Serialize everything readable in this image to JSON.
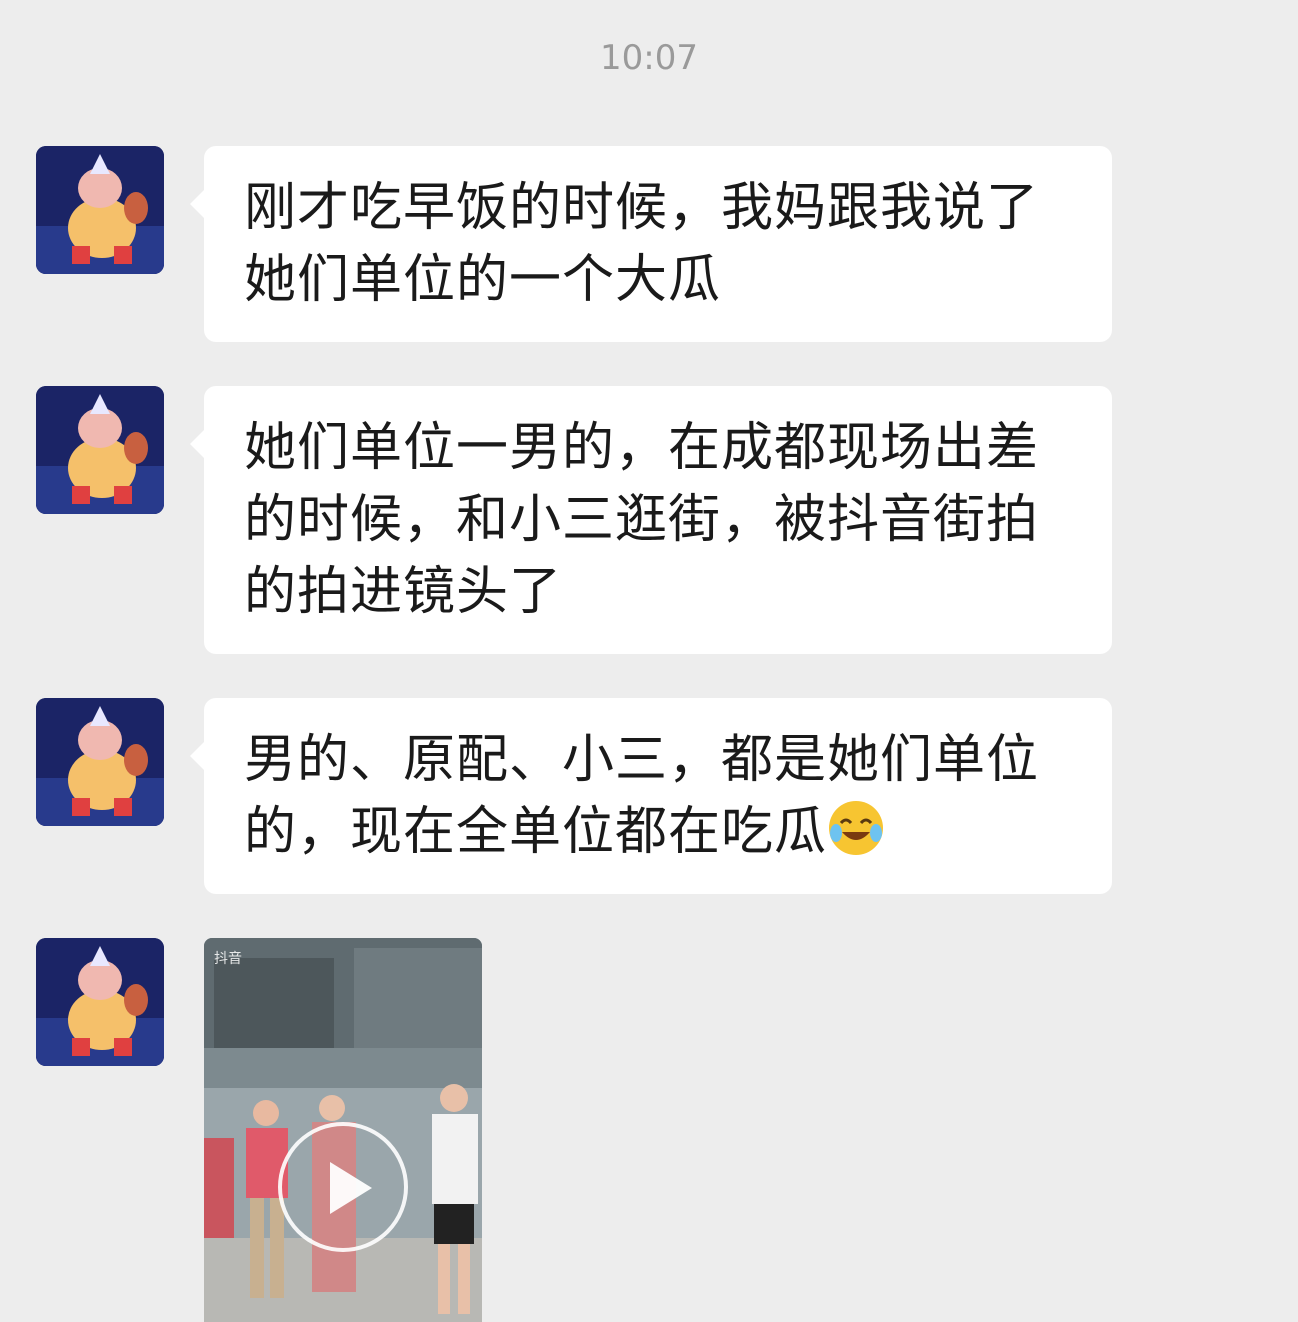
{
  "timestamp": "10:07",
  "messages": [
    {
      "text": "刚才吃早饭的时候，我妈跟我说了她们单位的一个大瓜"
    },
    {
      "text": "她们单位一男的，在成都现场出差的时候，和小三逛街，被抖音街拍的拍进镜头了"
    },
    {
      "text": "男的、原配、小三，都是她们单位的，现在全单位都在吃瓜",
      "emoji": "laughing-crying-emoji"
    }
  ],
  "video": {
    "platform_mark": "抖音",
    "play_icon": "play-icon"
  },
  "colors": {
    "background": "#ededed",
    "bubble": "#ffffff",
    "text": "#1a1a1a",
    "timestamp": "#9a9a9a"
  }
}
